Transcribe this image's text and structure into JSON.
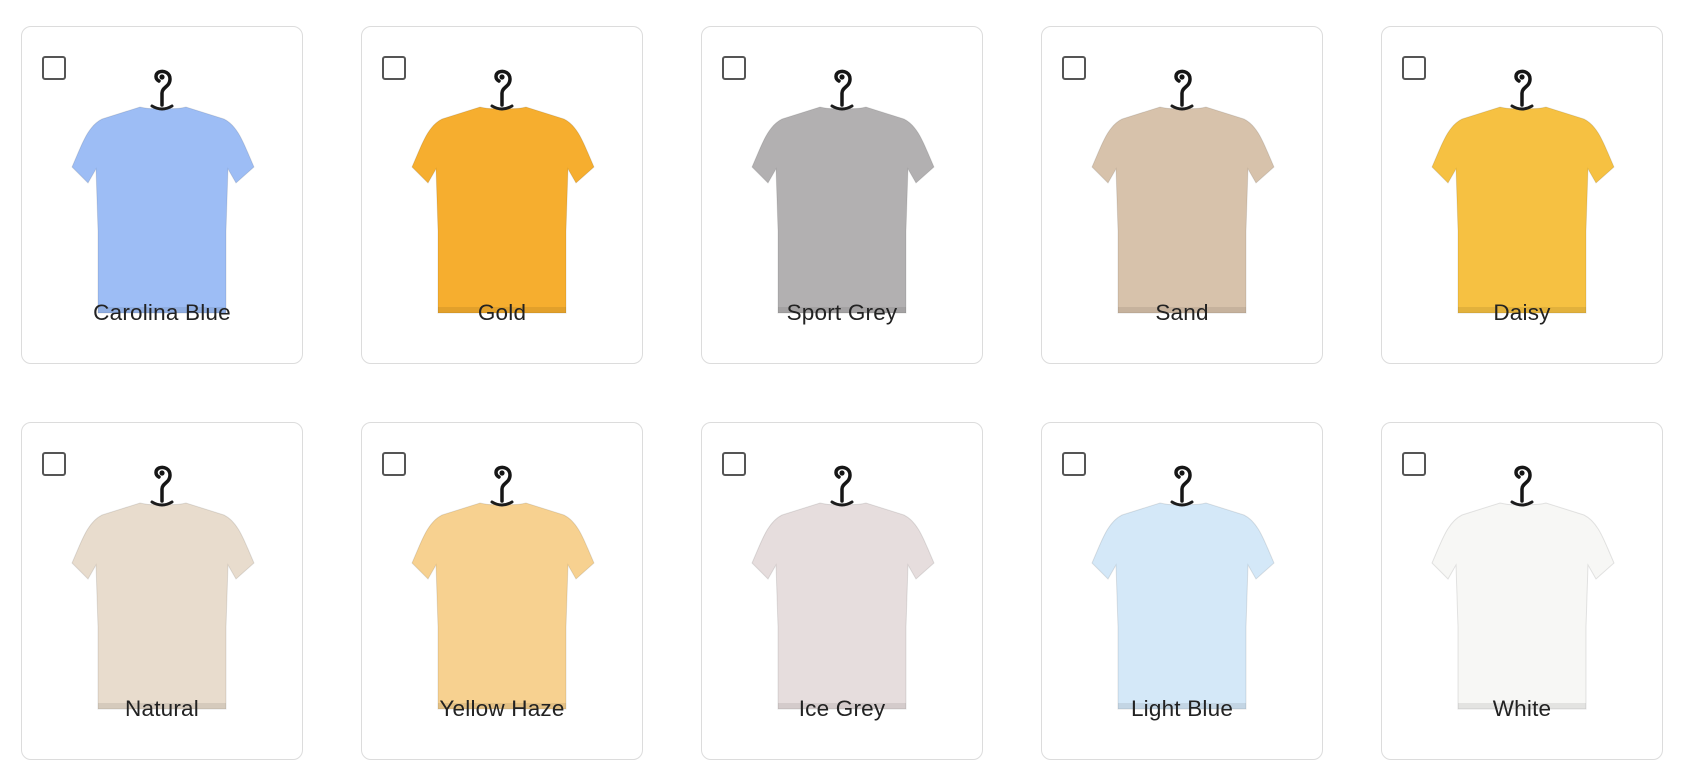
{
  "colors": [
    {
      "name": "Carolina Blue",
      "hex": "#9dbdf5",
      "selected": false
    },
    {
      "name": "Gold",
      "hex": "#f6ae2f",
      "selected": false
    },
    {
      "name": "Sport Grey",
      "hex": "#b2b0b1",
      "selected": false
    },
    {
      "name": "Sand",
      "hex": "#d7c2ab",
      "selected": false
    },
    {
      "name": "Daisy",
      "hex": "#f6c142",
      "selected": false
    },
    {
      "name": "Natural",
      "hex": "#e8dccd",
      "selected": false
    },
    {
      "name": "Yellow Haze",
      "hex": "#f7d190",
      "selected": false
    },
    {
      "name": "Ice Grey",
      "hex": "#e6dddd",
      "selected": false
    },
    {
      "name": "Light Blue",
      "hex": "#d4e8f8",
      "selected": false
    },
    {
      "name": "White",
      "hex": "#f7f7f5",
      "selected": false
    }
  ]
}
